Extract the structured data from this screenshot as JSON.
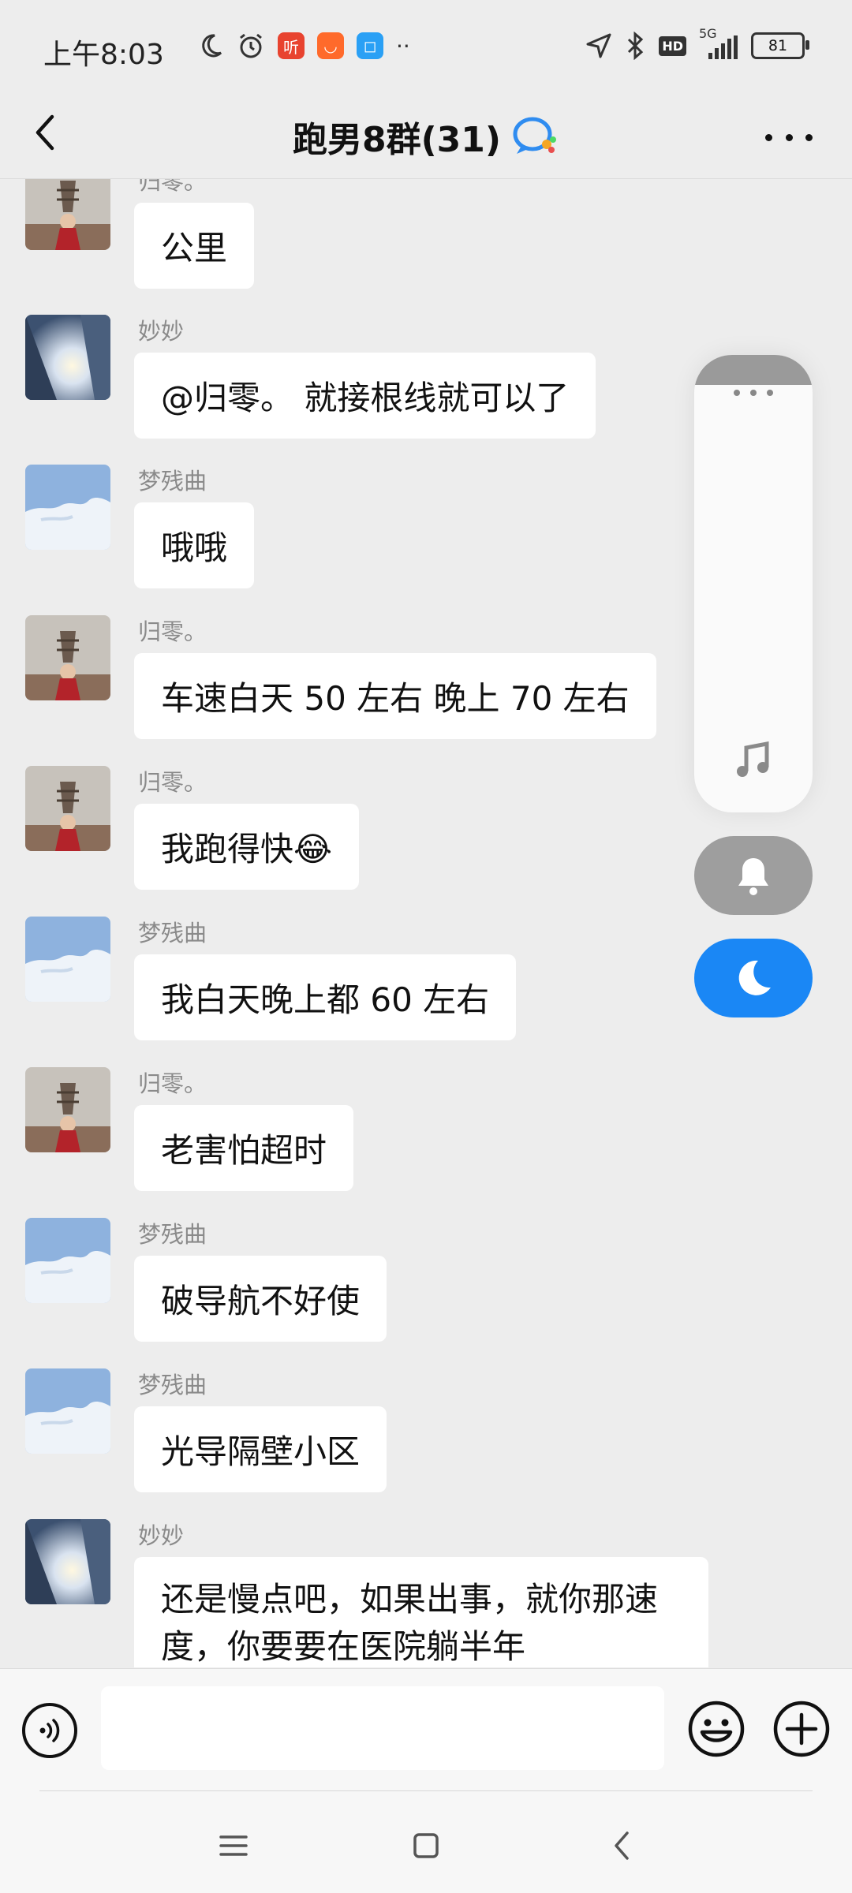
{
  "status_bar": {
    "time": "上午8:03",
    "network": "5G",
    "hd": "HD",
    "battery": "81",
    "app_icons": [
      "alarm-icon",
      "listen-app-icon",
      "shopping-app-icon",
      "chat-app-icon"
    ]
  },
  "header": {
    "title": "跑男8群(31)"
  },
  "messages": [
    {
      "sender": "归零。",
      "text": "公里",
      "avatar": "tower-avatar"
    },
    {
      "sender": "妙妙",
      "text": "@归零。 就接根线就可以了",
      "avatar": "sunset-building-avatar"
    },
    {
      "sender": "梦残曲",
      "text": "哦哦",
      "avatar": "sky-cloud-avatar"
    },
    {
      "sender": "归零。",
      "text": "车速白天 50 左右 晚上 70 左右",
      "avatar": "tower-avatar"
    },
    {
      "sender": "归零。",
      "text": "我跑得快",
      "emoji": "😂",
      "avatar": "tower-avatar"
    },
    {
      "sender": "梦残曲",
      "text": "我白天晚上都 60 左右",
      "avatar": "sky-cloud-avatar"
    },
    {
      "sender": "归零。",
      "text": "老害怕超时",
      "avatar": "tower-avatar"
    },
    {
      "sender": "梦残曲",
      "text": "破导航不好使",
      "avatar": "sky-cloud-avatar"
    },
    {
      "sender": "梦残曲",
      "text": "光导隔壁小区",
      "avatar": "sky-cloud-avatar"
    },
    {
      "sender": "妙妙",
      "text": "还是慢点吧，如果出事，就你那速度，你要要在医院躺半年",
      "avatar": "sunset-building-avatar"
    }
  ],
  "input_bar": {
    "placeholder": ""
  },
  "colors": {
    "background": "#ededed",
    "bubble": "#ffffff",
    "accent_blue": "#1a87f5",
    "bell_gray": "#9e9e9e"
  }
}
